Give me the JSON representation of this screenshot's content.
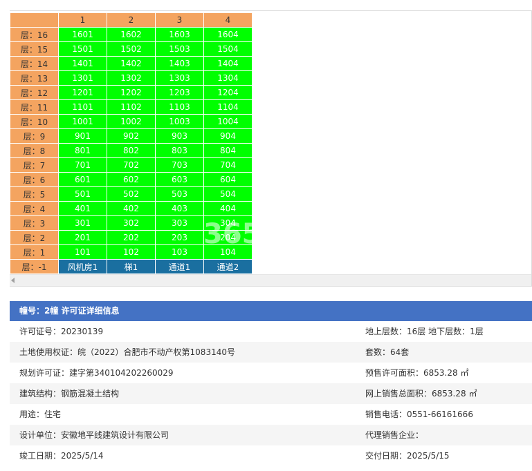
{
  "grid": {
    "columns": [
      "1",
      "2",
      "3",
      "4"
    ],
    "rows": [
      {
        "floor": "层：16",
        "units": [
          "1601",
          "1602",
          "1603",
          "1604"
        ]
      },
      {
        "floor": "层：15",
        "units": [
          "1501",
          "1502",
          "1503",
          "1504"
        ]
      },
      {
        "floor": "层：14",
        "units": [
          "1401",
          "1402",
          "1403",
          "1404"
        ]
      },
      {
        "floor": "层：13",
        "units": [
          "1301",
          "1302",
          "1303",
          "1304"
        ]
      },
      {
        "floor": "层：12",
        "units": [
          "1201",
          "1202",
          "1203",
          "1204"
        ]
      },
      {
        "floor": "层：11",
        "units": [
          "1101",
          "1102",
          "1103",
          "1104"
        ]
      },
      {
        "floor": "层：10",
        "units": [
          "1001",
          "1002",
          "1003",
          "1004"
        ]
      },
      {
        "floor": "层：9",
        "units": [
          "901",
          "902",
          "903",
          "904"
        ]
      },
      {
        "floor": "层：8",
        "units": [
          "801",
          "802",
          "803",
          "804"
        ]
      },
      {
        "floor": "层：7",
        "units": [
          "701",
          "702",
          "703",
          "704"
        ]
      },
      {
        "floor": "层：6",
        "units": [
          "601",
          "602",
          "603",
          "604"
        ]
      },
      {
        "floor": "层：5",
        "units": [
          "501",
          "502",
          "503",
          "504"
        ]
      },
      {
        "floor": "层：4",
        "units": [
          "401",
          "402",
          "403",
          "404"
        ]
      },
      {
        "floor": "层：3",
        "units": [
          "301",
          "302",
          "303",
          "304"
        ]
      },
      {
        "floor": "层：2",
        "units": [
          "201",
          "202",
          "203",
          "204"
        ]
      },
      {
        "floor": "层：1",
        "units": [
          "101",
          "102",
          "103",
          "104"
        ]
      },
      {
        "floor": "层：-1",
        "units": [
          "风机房1",
          "梯1",
          "通道1",
          "通道2"
        ],
        "special": true
      }
    ],
    "unit_color": "#00ff00",
    "header_color": "#f4a460",
    "special_color": "#1a6fa0",
    "watermark": "365"
  },
  "info": {
    "header": "幢号：2幢 许可证详细信息",
    "header_color": "#4472c4",
    "rows": [
      {
        "left": "许可证号：20230139",
        "right": "地上层数：16层  地下层数：1层"
      },
      {
        "left": "土地使用权证：皖（2022）合肥市不动产权第1083140号",
        "right": "套数：64套"
      },
      {
        "left": "规划许可证：建字第340104202260029",
        "right": "预售许可面积：6853.28 ㎡"
      },
      {
        "left": "建筑结构：钢筋混凝土结构",
        "right": "网上销售总面积：6853.28 ㎡"
      },
      {
        "left": "用途：住宅",
        "right": "销售电话：0551-66161666"
      },
      {
        "left": "设计单位：安徽地平线建筑设计有限公司",
        "right": "代理销售企业："
      },
      {
        "left": "竣工日期：2025/5/14",
        "right": "交付日期：2025/5/15"
      }
    ]
  }
}
